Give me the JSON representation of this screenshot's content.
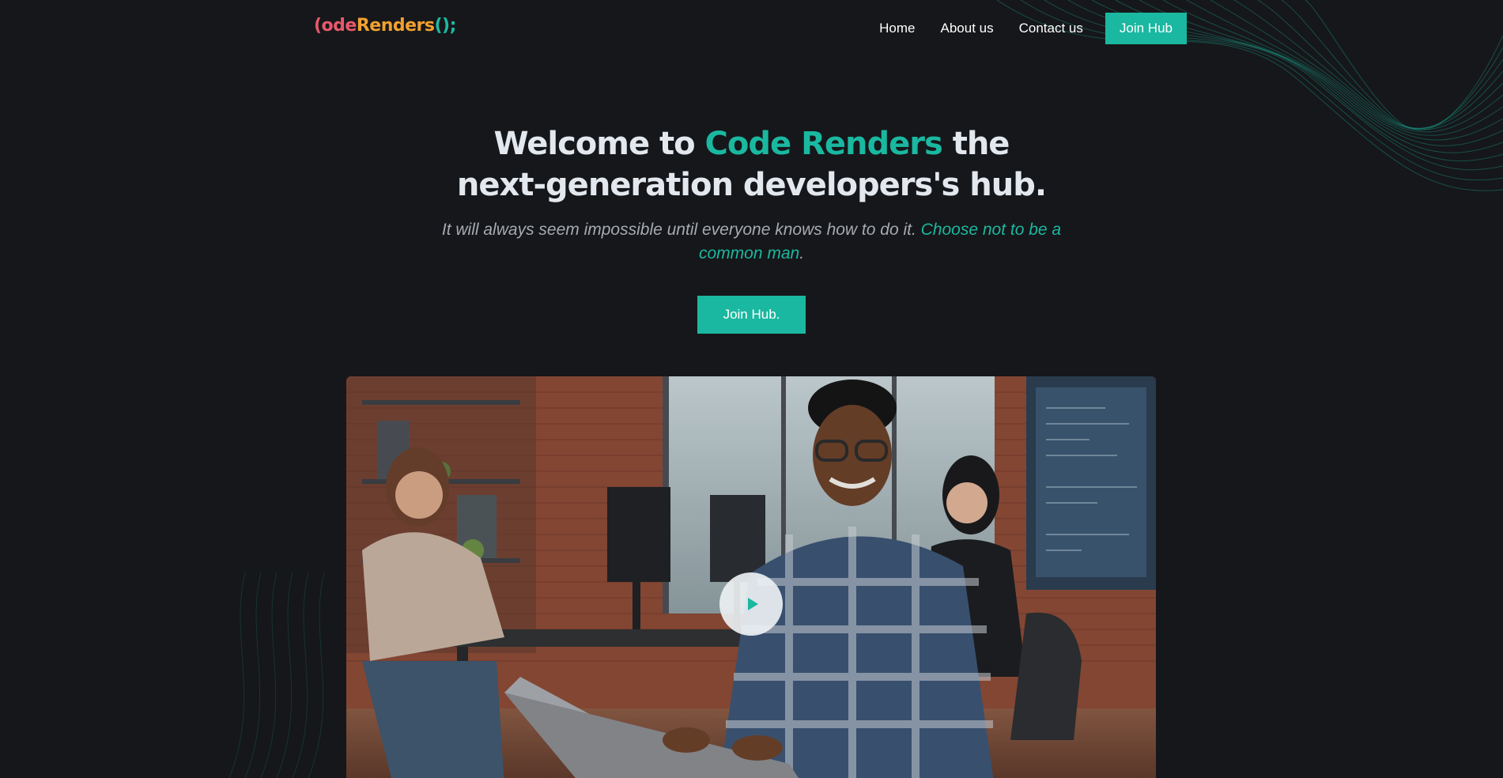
{
  "logo": {
    "part1": "(ode",
    "part2": "Renders",
    "part3": "();"
  },
  "nav": {
    "home": "Home",
    "about": "About us",
    "contact": "Contact us",
    "cta": "Join Hub"
  },
  "hero": {
    "title_pre": "Welcome to ",
    "title_accent": "Code Renders",
    "title_post": " the next-generation developers's hub.",
    "sub_pre": "It will always seem impossible until everyone knows how to do it. ",
    "sub_accent": "Choose not to be a common man",
    "sub_post": ".",
    "button": "Join Hub."
  },
  "media": {
    "play_icon": "play-icon"
  },
  "colors": {
    "accent": "#1ab8a0",
    "background": "#16171a",
    "logo_red": "#e8586a",
    "logo_orange": "#f0a030"
  }
}
